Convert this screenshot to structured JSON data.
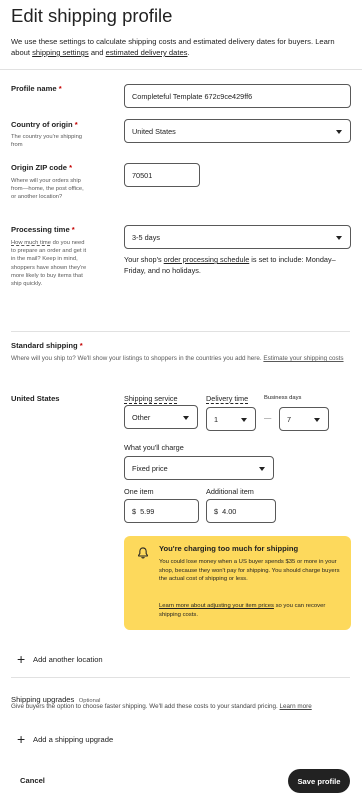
{
  "page": {
    "title": "Edit shipping profile",
    "intro_text": "We use these settings to calculate shipping costs and estimated delivery dates for buyers. Learn about ",
    "intro_link1": "shipping settings",
    "intro_and": " and ",
    "intro_link2": "estimated delivery dates",
    "intro_end": "."
  },
  "profile_name": {
    "label": "Profile name",
    "required": "*",
    "value": "Completeful Template 672c9ce429ff6"
  },
  "country": {
    "label": "Country of origin",
    "required": "*",
    "hint": "The country you're shipping from",
    "value": "United States"
  },
  "zip": {
    "label": "Origin ZIP code",
    "required": "*",
    "hint": "Where will your orders ship from—home, the post office, or another location?",
    "value": "70501"
  },
  "processing": {
    "label": "Processing time",
    "required": "*",
    "hint_dashed": "How much time",
    "hint_rest": " do you need to prepare an order and get it in the mail? Keep in mind, shoppers have shown they're more likely to buy items that ship quickly.",
    "value": "3-5 days",
    "note_pre": "Your shop's ",
    "note_link": "order processing schedule",
    "note_post": " is set to include: Monday–Friday, and no holidays."
  },
  "standard_shipping": {
    "label": "Standard shipping",
    "required": "*",
    "desc": "Where will you ship to? We'll show your listings to shoppers in the countries you add here. ",
    "desc_link": "Estimate your shipping costs",
    "location": "United States",
    "service_label": "Shipping service",
    "service_value": "Other",
    "delivery_label": "Delivery time",
    "business_days": "Business days",
    "delivery_min": "1",
    "delivery_dash": "—",
    "delivery_max": "7",
    "charge_label": "What you'll charge",
    "charge_value": "Fixed price",
    "one_item_label": "One item",
    "one_item_currency": "$",
    "one_item_value": "5.99",
    "additional_label": "Additional item",
    "additional_currency": "$",
    "additional_value": "4.00"
  },
  "alert": {
    "title": "You're charging too much for shipping",
    "body": "You could lose money when a US buyer spends $35 or more in your shop, because they won't pay for shipping. You should charge buyers the actual cost of shipping or less.",
    "link": "Learn more about adjusting your item prices",
    "link_rest": " so you can recover shipping costs.",
    "icon": "bell-icon",
    "bg_color": "#fdd95c"
  },
  "add_location": {
    "plus": "+",
    "label": "Add another location"
  },
  "upgrades": {
    "label": "Shipping upgrades",
    "optional": "Optional",
    "desc": "Give buyers the option to choose faster shipping. We'll add these costs to your standard pricing. ",
    "desc_link": "Learn more",
    "add_plus": "+",
    "add_label": "Add a shipping upgrade"
  },
  "footer": {
    "cancel": "Cancel",
    "save": "Save profile"
  }
}
